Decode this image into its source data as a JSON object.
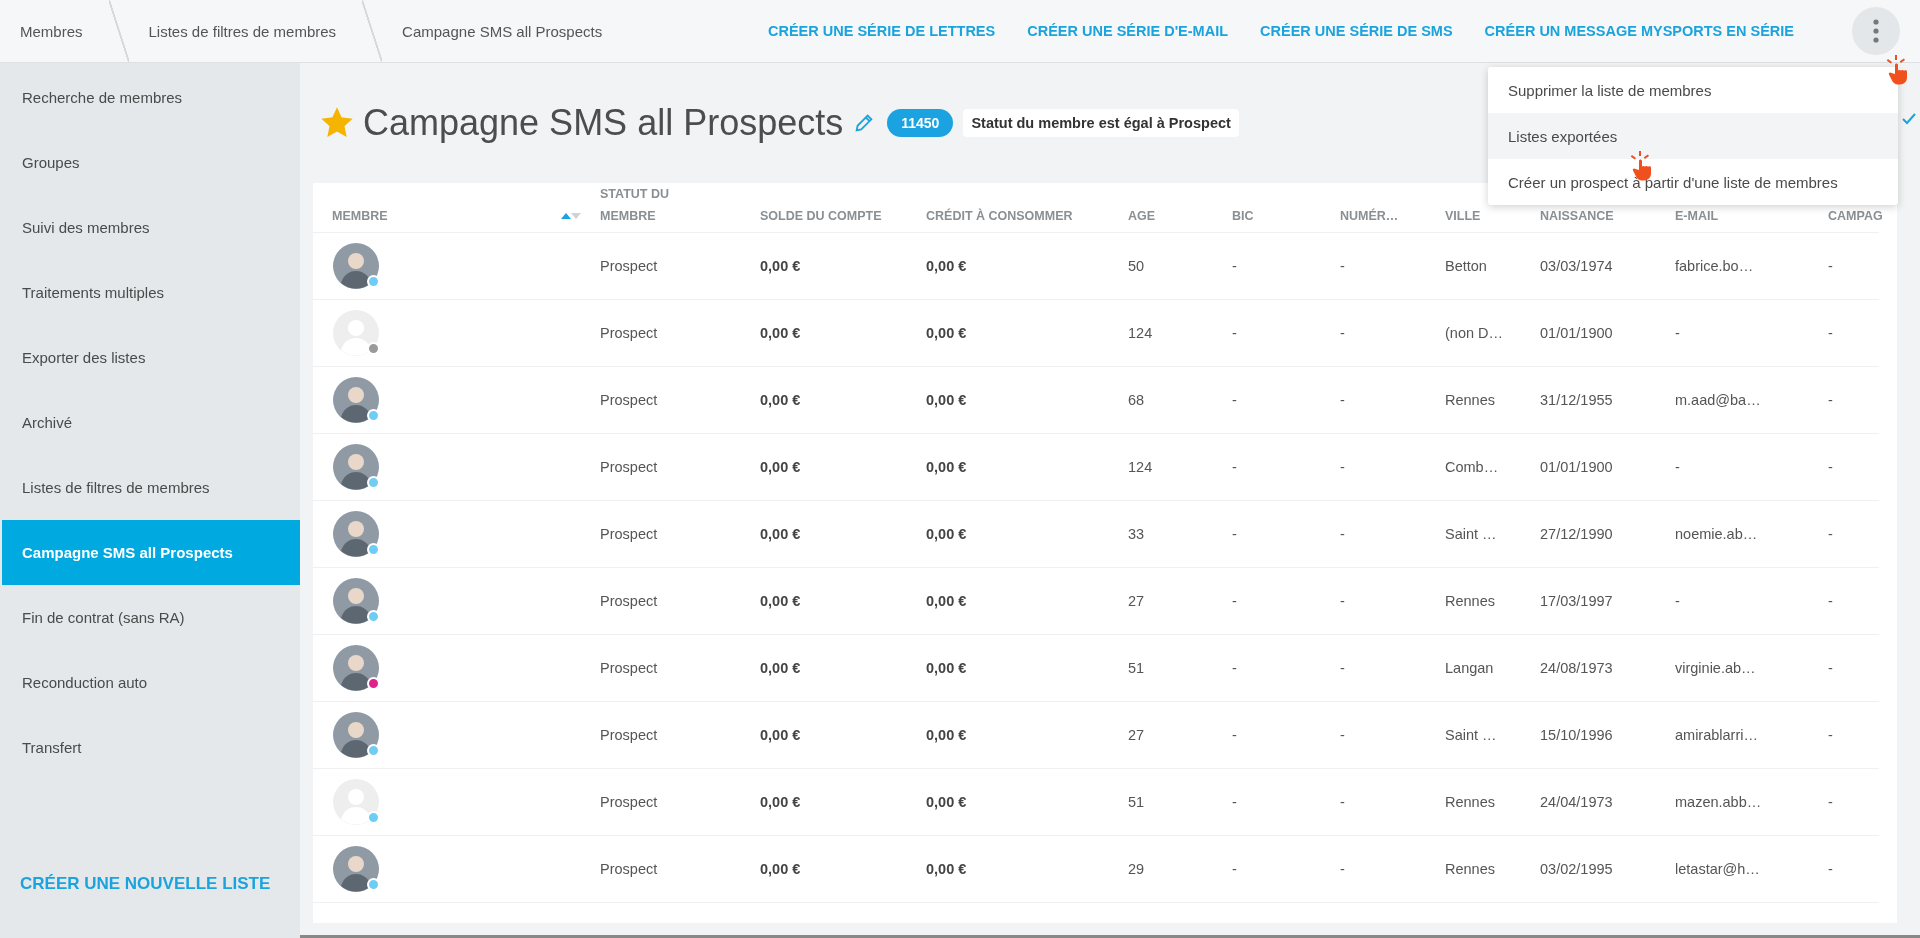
{
  "breadcrumbs": [
    {
      "label": "Membres"
    },
    {
      "label": "Listes de filtres de membres"
    },
    {
      "label": "Campagne SMS all Prospects"
    }
  ],
  "actions": [
    "CRÉER UNE SÉRIE DE LETTRES",
    "CRÉER UNE SÉRIE D'E-MAIL",
    "CRÉER UNE SÉRIE DE SMS",
    "CRÉER UN MESSAGE MYSPORTS EN SÉRIE"
  ],
  "menu": {
    "items": [
      {
        "label": "Supprimer la liste de membres",
        "highlighted": false
      },
      {
        "label": "Listes exportées",
        "highlighted": true
      },
      {
        "label": "Créer un prospect à partir d'une liste de membres",
        "highlighted": false
      }
    ]
  },
  "sidebar": {
    "items": [
      {
        "label": "Recherche de membres",
        "selected": false
      },
      {
        "label": "Groupes",
        "selected": false
      },
      {
        "label": "Suivi des membres",
        "selected": false
      },
      {
        "label": "Traitements multiples",
        "selected": false
      },
      {
        "label": "Exporter des listes",
        "selected": false
      },
      {
        "label": "Archivé",
        "selected": false
      },
      {
        "label": "Listes de filtres de membres",
        "selected": false
      },
      {
        "label": "Campagne SMS all Prospects",
        "selected": true
      },
      {
        "label": "Fin de contrat (sans RA)",
        "selected": false
      },
      {
        "label": "Reconduction auto",
        "selected": false
      },
      {
        "label": "Transfert",
        "selected": false
      }
    ],
    "create_link": "CRÉER UNE NOUVELLE LISTE"
  },
  "page": {
    "title": "Campagne SMS all Prospects",
    "favorite": true,
    "count": "11450",
    "filter": "Statut du membre est égal à Prospect"
  },
  "table": {
    "columns": [
      {
        "label": "MEMBRE",
        "sorted": true
      },
      {
        "label": "STATUT DU MEMBRE",
        "sorted": false
      },
      {
        "label": "SOLDE DU COMPTE",
        "sorted": false
      },
      {
        "label": "CRÉDIT À CONSOMMER",
        "sorted": false
      },
      {
        "label": "AGE",
        "sorted": false
      },
      {
        "label": "BIC",
        "sorted": false
      },
      {
        "label": "NUMÉR…",
        "sorted": false
      },
      {
        "label": "VILLE",
        "sorted": false
      },
      {
        "label": "NAISSANCE",
        "sorted": false
      },
      {
        "label": "E-MAIL",
        "sorted": false
      },
      {
        "label": "CAMPAG",
        "sorted": false
      }
    ],
    "rows": [
      {
        "cells": [
          {
            "kind": "photo",
            "color": "#6fcdf5"
          },
          "Prospect",
          "0,00 €",
          "0,00 €",
          "50",
          "-",
          "-",
          "Betton",
          "03/03/1974",
          "fabrice.bo…",
          "-"
        ]
      },
      {
        "cells": [
          {
            "kind": "placeholder",
            "color": "#9a9a9a"
          },
          "Prospect",
          "0,00 €",
          "0,00 €",
          "124",
          "-",
          "-",
          "(non D…",
          "01/01/1900",
          "-",
          "-"
        ]
      },
      {
        "cells": [
          {
            "kind": "photo",
            "color": "#6fcdf5"
          },
          "Prospect",
          "0,00 €",
          "0,00 €",
          "68",
          "-",
          "-",
          "Rennes",
          "31/12/1955",
          "m.aad@ba…",
          "-"
        ]
      },
      {
        "cells": [
          {
            "kind": "photo",
            "color": "#6fcdf5"
          },
          "Prospect",
          "0,00 €",
          "0,00 €",
          "124",
          "-",
          "-",
          "Comb…",
          "01/01/1900",
          "-",
          "-"
        ]
      },
      {
        "cells": [
          {
            "kind": "photo",
            "color": "#6fcdf5"
          },
          "Prospect",
          "0,00 €",
          "0,00 €",
          "33",
          "-",
          "-",
          "Saint …",
          "27/12/1990",
          "noemie.ab…",
          "-"
        ]
      },
      {
        "cells": [
          {
            "kind": "photo",
            "color": "#6fcdf5"
          },
          "Prospect",
          "0,00 €",
          "0,00 €",
          "27",
          "-",
          "-",
          "Rennes",
          "17/03/1997",
          "-",
          "-"
        ]
      },
      {
        "cells": [
          {
            "kind": "photo",
            "color": "#e0218a"
          },
          "Prospect",
          "0,00 €",
          "0,00 €",
          "51",
          "-",
          "-",
          "Langan",
          "24/08/1973",
          "virginie.ab…",
          "-"
        ]
      },
      {
        "cells": [
          {
            "kind": "photo",
            "color": "#6fcdf5"
          },
          "Prospect",
          "0,00 €",
          "0,00 €",
          "27",
          "-",
          "-",
          "Saint …",
          "15/10/1996",
          "amirablarri…",
          "-"
        ]
      },
      {
        "cells": [
          {
            "kind": "placeholder",
            "color": "#6fcdf5"
          },
          "Prospect",
          "0,00 €",
          "0,00 €",
          "51",
          "-",
          "-",
          "Rennes",
          "24/04/1973",
          "mazen.abb…",
          "-"
        ]
      },
      {
        "cells": [
          {
            "kind": "photo",
            "color": "#6fcdf5"
          },
          "Prospect",
          "0,00 €",
          "0,00 €",
          "29",
          "-",
          "-",
          "Rennes",
          "03/02/1995",
          "letastar@h…",
          "-"
        ]
      }
    ]
  }
}
